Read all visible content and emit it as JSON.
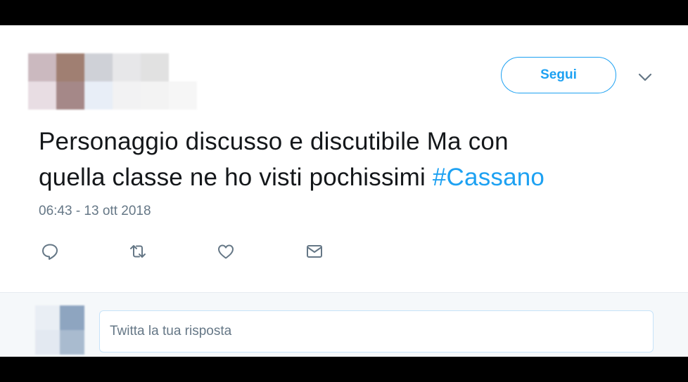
{
  "tweet": {
    "text_line1": "Personaggio discusso e discutibile Ma con",
    "text_line2": "quella classe ne ho visti pochissimi ",
    "hashtag": "#Cassano",
    "timestamp": "06:43 - 13 ott 2018"
  },
  "header": {
    "follow_label": "Segui"
  },
  "actions": {
    "reply_icon": "reply-icon",
    "retweet_icon": "retweet-icon",
    "like_icon": "heart-icon",
    "dm_icon": "envelope-icon"
  },
  "reply": {
    "placeholder": "Twitta la tua risposta"
  },
  "colors": {
    "accent": "#1da1f2",
    "text": "#14171a",
    "muted": "#657786",
    "reply_bg": "#f5f8fa"
  }
}
